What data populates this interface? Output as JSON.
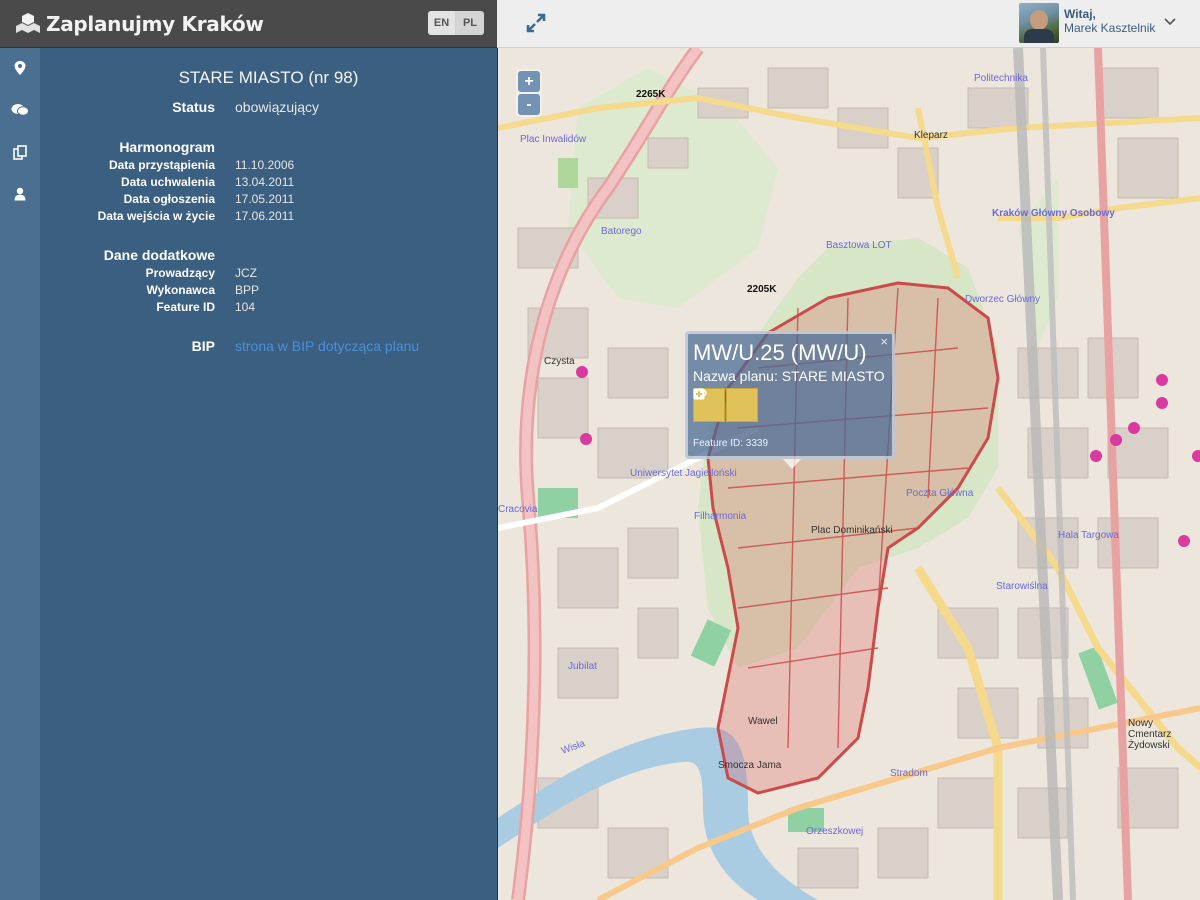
{
  "app": {
    "title": "Zaplanujmy Kraków"
  },
  "languages": [
    "EN",
    "PL"
  ],
  "user": {
    "greeting": "Witaj,",
    "name": "Marek Kasztelnik"
  },
  "sidebar_icons": [
    "map-marker-icon",
    "chat-icon",
    "documents-icon",
    "user-icon"
  ],
  "plan": {
    "title": "STARE MIASTO (nr 98)",
    "status_label": "Status",
    "status_value": "obowiązujący",
    "schedule_heading": "Harmonogram",
    "schedule": [
      {
        "label": "Data przystąpienia",
        "value": "11.10.2006"
      },
      {
        "label": "Data uchwalenia",
        "value": "13.04.2011"
      },
      {
        "label": "Data ogłoszenia",
        "value": "17.05.2011"
      },
      {
        "label": "Data wejścia w życie",
        "value": "17.06.2011"
      }
    ],
    "extra_heading": "Dane dodatkowe",
    "extra": [
      {
        "label": "Prowadzący",
        "value": "JCZ"
      },
      {
        "label": "Wykonawca",
        "value": "BPP"
      },
      {
        "label": "Feature ID",
        "value": "104"
      }
    ],
    "bip_label": "BIP",
    "bip_link": "strona w BIP dotycząca planu"
  },
  "map": {
    "zoom_in": "+",
    "zoom_out": "-",
    "popup": {
      "title": "MW/U.25 (MW/U)",
      "subtitle": "Nazwa planu: STARE MIASTO",
      "feature_id": "Feature ID: 3339",
      "close": "×"
    },
    "labels": [
      "Plac Inwalidów",
      "Batorego",
      "Czysta",
      "Uniwersytet Jagielloński",
      "Filharmonia",
      "Plac Dominikański",
      "Poczta Główna",
      "Dworzec Główny",
      "Kraków Główny Osobowy",
      "Wawel",
      "Smocza Jama",
      "Jubilat",
      "Hala Targowa",
      "Starowiślna",
      "Stradom",
      "Orzeszkowej",
      "Politechnika",
      "Kleparz",
      "Basztowa LOT",
      "Nowy Cmentarz Żydowski",
      "2265K",
      "2205K",
      "Wisła",
      "Cracovia"
    ]
  }
}
